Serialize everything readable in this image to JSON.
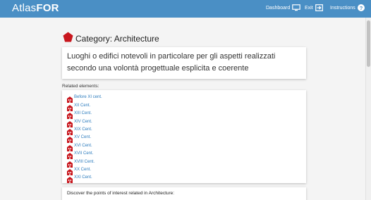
{
  "header": {
    "brand_main": "Atlas",
    "brand_bold": "FOR",
    "dashboard_label": "Dashboard",
    "exit_label": "Exit",
    "instructions_label": "Instructions",
    "color": "#4a8fc5"
  },
  "category": {
    "title": "Category: Architecture",
    "icon": "red-pentagon-icon",
    "icon_color": "#c8161d",
    "description": "Luoghi o edifici notevoli in particolare per gli aspetti realizzati secondo una volontà progettuale esplicita e coerente"
  },
  "related": {
    "title": "Related elements:",
    "items": [
      {
        "label": "Before XI cent."
      },
      {
        "label": "XII Cent."
      },
      {
        "label": "XIII Cent."
      },
      {
        "label": "XIV Cent."
      },
      {
        "label": "XIX Cent."
      },
      {
        "label": "XV Cent."
      },
      {
        "label": "XVI Cent."
      },
      {
        "label": "XVII Cent."
      },
      {
        "label": "XVIII Cent."
      },
      {
        "label": "XX Cent."
      },
      {
        "label": "XXI Cent."
      }
    ]
  },
  "poi": {
    "text": "Discover the points of interest related in Architecture:"
  }
}
